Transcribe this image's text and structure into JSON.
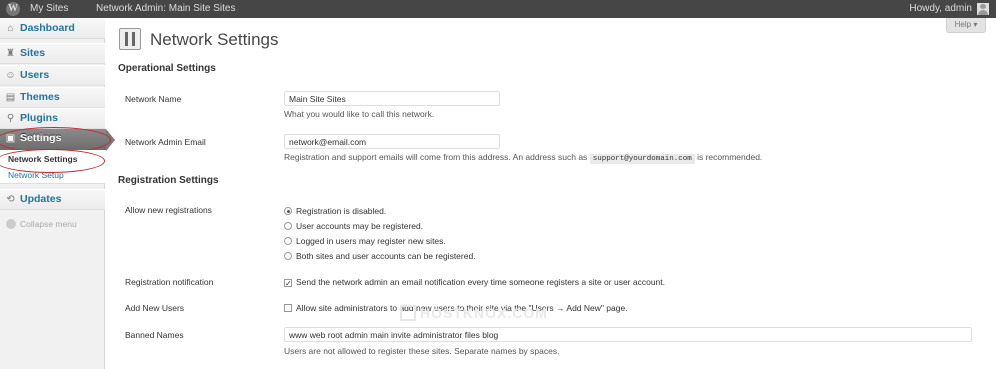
{
  "admin_bar": {
    "my_sites": "My Sites",
    "network_admin": "Network Admin: Main Site Sites",
    "howdy": "Howdy, admin"
  },
  "sidebar": {
    "items": [
      {
        "label": "Dashboard",
        "icon": "dashboard-icon"
      },
      {
        "label": "Sites",
        "icon": "sites-icon"
      },
      {
        "label": "Users",
        "icon": "users-icon"
      },
      {
        "label": "Themes",
        "icon": "themes-icon"
      },
      {
        "label": "Plugins",
        "icon": "plugins-icon"
      },
      {
        "label": "Settings",
        "icon": "settings-icon"
      },
      {
        "label": "Updates",
        "icon": "updates-icon"
      }
    ],
    "submenu": [
      "Network Settings",
      "Network Setup"
    ],
    "collapse_label": "Collapse menu"
  },
  "main": {
    "help_label": "Help ▾",
    "page_title": "Network Settings",
    "operational": {
      "title": "Operational Settings",
      "network_name_label": "Network Name",
      "network_name_value": "Main Site Sites",
      "network_name_desc": "What you would like to call this network.",
      "admin_email_label": "Network Admin Email",
      "admin_email_value": "network@email.com",
      "admin_email_desc_before": "Registration and support emails will come from this address. An address such as",
      "admin_email_desc_code": "support@yourdomain.com",
      "admin_email_desc_after": "is recommended."
    },
    "registration": {
      "title": "Registration Settings",
      "allow_label": "Allow new registrations",
      "options": [
        {
          "label": "Registration is disabled.",
          "checked": true
        },
        {
          "label": "User accounts may be registered.",
          "checked": false
        },
        {
          "label": "Logged in users may register new sites.",
          "checked": false
        },
        {
          "label": "Both sites and user accounts can be registered.",
          "checked": false
        }
      ],
      "notification_label": "Registration notification",
      "notification_text": "Send the network admin an email notification every time someone registers a site or user account.",
      "notification_checked": true,
      "add_users_label": "Add New Users",
      "add_users_text": "Allow site administrators to add new users to their site via the \"Users → Add New\" page.",
      "add_users_checked": false,
      "banned_label": "Banned Names",
      "banned_value": "www web root admin main invite administrator files blog",
      "banned_desc": "Users are not allowed to register these sites. Separate names by spaces."
    },
    "watermark": "HOSTKNOX.COM"
  }
}
